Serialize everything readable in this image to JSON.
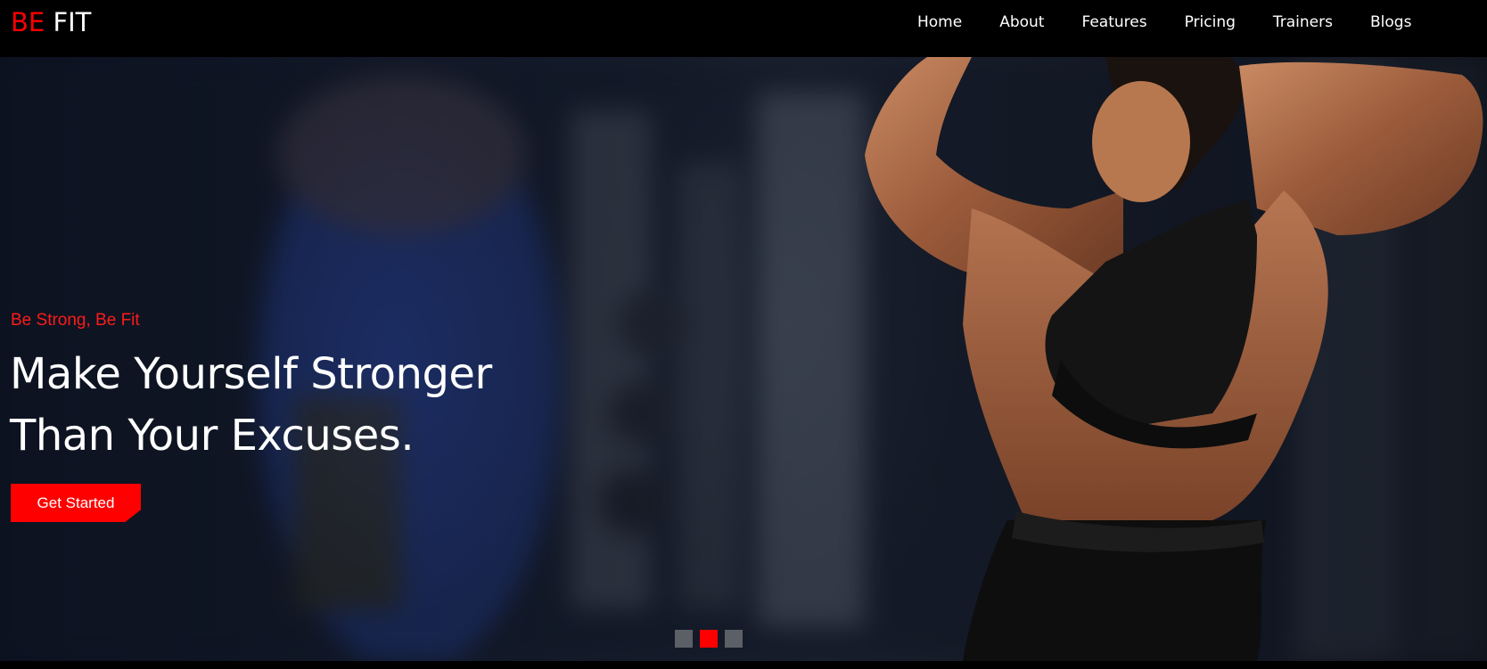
{
  "brand": {
    "accent": "BE",
    "rest": "FIT"
  },
  "nav": {
    "items": [
      {
        "label": "Home"
      },
      {
        "label": "About"
      },
      {
        "label": "Features"
      },
      {
        "label": "Pricing"
      },
      {
        "label": "Trainers"
      },
      {
        "label": "Blogs"
      }
    ]
  },
  "hero": {
    "tagline": "Be Strong, Be Fit",
    "headline": "Make Yourself Stronger Than Your Excuses.",
    "cta_label": "Get Started"
  },
  "carousel": {
    "slide_count": 3,
    "active_index": 1
  },
  "colors": {
    "accent": "#ff0000",
    "background": "#000000",
    "inactive_dot": "#5b5f66"
  }
}
